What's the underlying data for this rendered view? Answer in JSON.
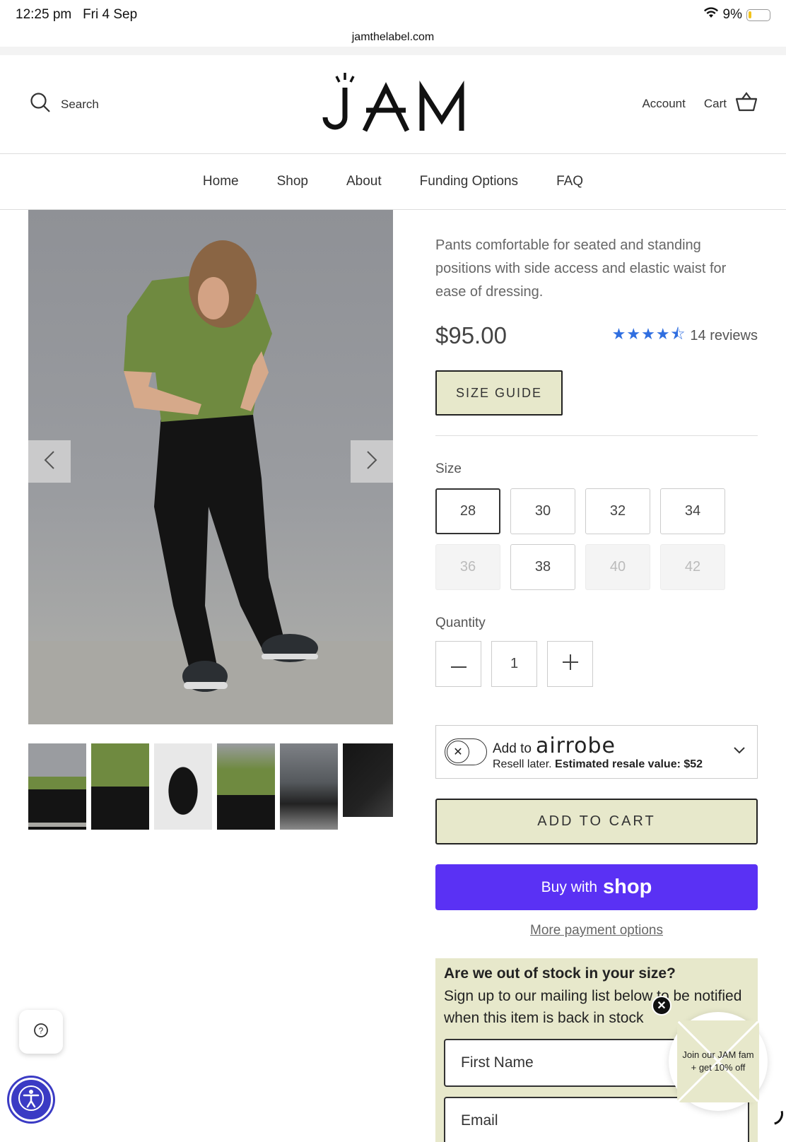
{
  "status_bar": {
    "time": "12:25 pm",
    "date": "Fri 4 Sep",
    "battery": "9%"
  },
  "browser": {
    "url": "jamthelabel.com"
  },
  "header": {
    "search_label": "Search",
    "logo_text": "JAM",
    "account_label": "Account",
    "cart_label": "Cart"
  },
  "nav": {
    "items": [
      "Home",
      "Shop",
      "About",
      "Funding Options",
      "FAQ"
    ]
  },
  "gallery": {
    "thumbnail_count": 6,
    "selected_thumbnail": 0
  },
  "product": {
    "description": "Pants comfortable for seated and standing positions with side access and elastic waist for ease of dressing.",
    "price": "$95.00",
    "rating": 4.5,
    "reviews_label": "14 reviews",
    "size_guide_label": "SIZE GUIDE",
    "size_label": "Size",
    "sizes": [
      {
        "label": "28",
        "state": "selected"
      },
      {
        "label": "30",
        "state": "available"
      },
      {
        "label": "32",
        "state": "available"
      },
      {
        "label": "34",
        "state": "available"
      },
      {
        "label": "36",
        "state": "unavailable"
      },
      {
        "label": "38",
        "state": "available"
      },
      {
        "label": "40",
        "state": "unavailable"
      },
      {
        "label": "42",
        "state": "unavailable"
      }
    ],
    "quantity_label": "Quantity",
    "quantity_value": "1",
    "airrobe": {
      "add_to": "Add to",
      "brand": "airrobe",
      "resell": "Resell later.",
      "estimate": "Estimated resale value: $52"
    },
    "add_to_cart_label": "ADD TO CART",
    "buy_with_label": "Buy with",
    "shop_label": "shop",
    "more_payment_label": "More payment options",
    "out_of_stock": {
      "title": "Are we out of stock in your size?",
      "body": "Sign up to our mailing list below to be notified when this item is back in stock",
      "first_name_placeholder": "First Name",
      "email_placeholder": "Email"
    }
  },
  "promo": {
    "text": "Join our JAM fam + get 10% off"
  },
  "colors": {
    "accent_beige": "#e7e8cb",
    "shop_purple": "#5a31f4",
    "star_blue": "#2f6ee0"
  }
}
